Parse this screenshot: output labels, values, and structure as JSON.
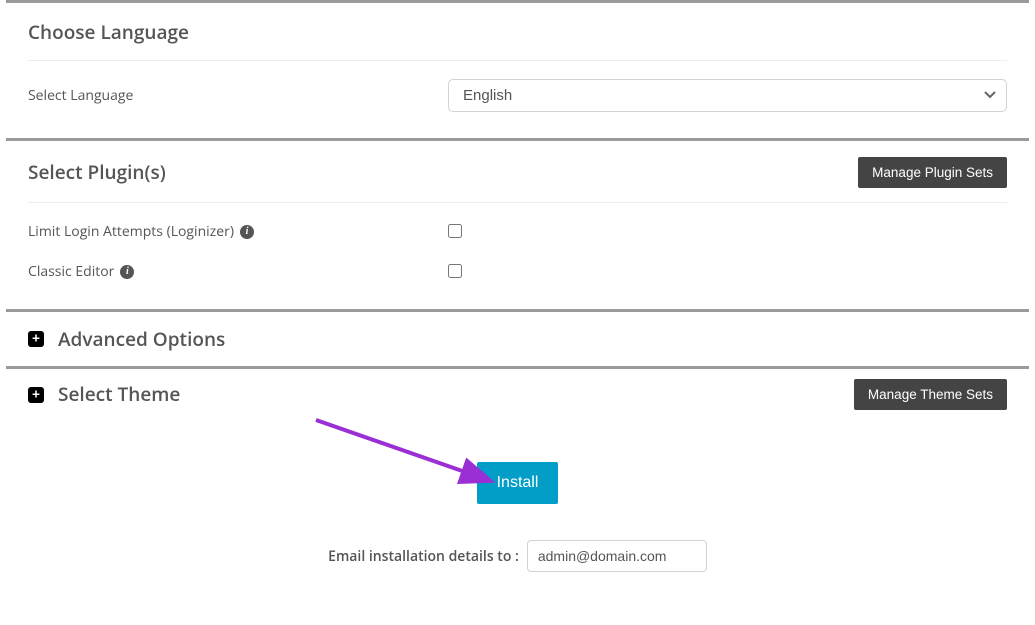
{
  "language": {
    "section_title": "Choose Language",
    "label": "Select Language",
    "selected": "English"
  },
  "plugins": {
    "section_title": "Select Plugin(s)",
    "manage_btn": "Manage Plugin Sets",
    "items": [
      {
        "label": "Limit Login Attempts (Loginizer)",
        "checked": false
      },
      {
        "label": "Classic Editor",
        "checked": false
      }
    ]
  },
  "advanced": {
    "section_title": "Advanced Options"
  },
  "theme": {
    "section_title": "Select Theme",
    "manage_btn": "Manage Theme Sets"
  },
  "install_btn": "Install",
  "email": {
    "label": "Email installation details to :",
    "value": "admin@domain.com"
  },
  "annotation_arrow_color": "#9b2fd6"
}
